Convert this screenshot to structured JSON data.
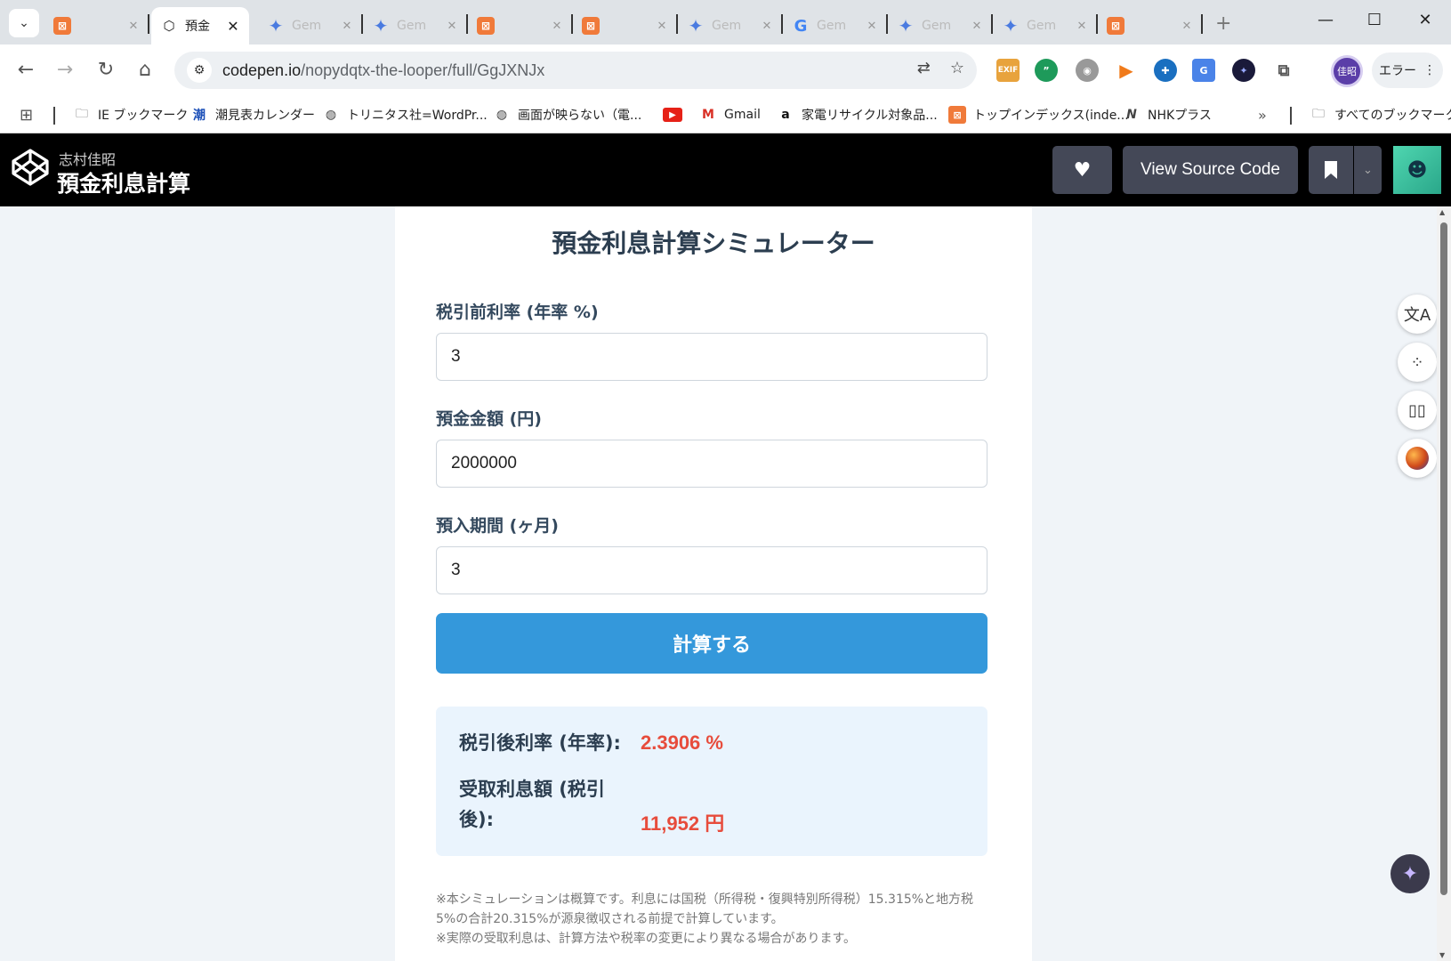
{
  "browser": {
    "tabs": [
      {
        "title": "",
        "icon": "codepen-icon"
      },
      {
        "title": "預金",
        "icon": "codepen-icon",
        "active": true
      },
      {
        "title": "Gem",
        "icon": "gemini-icon"
      },
      {
        "title": "Gem",
        "icon": "gemini-icon"
      },
      {
        "title": "",
        "icon": "codepen-icon"
      },
      {
        "title": "",
        "icon": "codepen-icon"
      },
      {
        "title": "Gem",
        "icon": "gemini-icon"
      },
      {
        "title": "Gem",
        "icon": "google-icon"
      },
      {
        "title": "Gem",
        "icon": "gemini-icon"
      },
      {
        "title": "Gem",
        "icon": "gemini-icon"
      },
      {
        "title": "",
        "icon": "codepen-icon"
      }
    ],
    "url_host": "codepen.io",
    "url_path": "/nopydqtx-the-looper/full/GgJXNJx",
    "profile_label": "佳昭",
    "error_button": "エラー",
    "bookmarks": [
      {
        "label": "IE ブックマーク",
        "icon": "folder-icon"
      },
      {
        "label": "潮見表カレンダー",
        "icon": "tide-icon"
      },
      {
        "label": "トリニタス社=WordPr...",
        "icon": "globe-icon"
      },
      {
        "label": "画面が映らない（電...",
        "icon": "globe-icon"
      },
      {
        "label": "",
        "icon": "youtube-icon"
      },
      {
        "label": "Gmail",
        "icon": "gmail-icon"
      },
      {
        "label": "家電リサイクル対象品...",
        "icon": "amazon-icon"
      },
      {
        "label": "トップインデックス(inde...",
        "icon": "codepen-icon"
      },
      {
        "label": "NHKプラス",
        "icon": "nhk-icon"
      }
    ],
    "all_bookmarks": "すべてのブックマーク",
    "colors": {
      "accent": "#3498db",
      "result_value": "#e74c3c"
    }
  },
  "codepen": {
    "author": "志村佳昭",
    "pen_title": "預金利息計算",
    "view_source": "View Source Code"
  },
  "simulator": {
    "title": "預金利息計算シミュレーター",
    "rate_label": "税引前利率 (年率 %)",
    "rate_value": "3",
    "amount_label": "預金金額 (円)",
    "amount_value": "2000000",
    "period_label": "預入期間 (ヶ月)",
    "period_value": "3",
    "button": "計算する",
    "result_rate_label": "税引後利率 (年率):",
    "result_rate_value": "2.3906 %",
    "result_interest_label_1": "受取利息額 (税引",
    "result_interest_label_2": "後):",
    "result_interest_value": "11,952 円",
    "note_1": "※本シミュレーションは概算です。利息には国税（所得税・復興特別所得税）15.315%と地方税5%の合計20.315%が源泉徴収される前提で計算しています。",
    "note_2": "※実際の受取利息は、計算方法や税率の変更により異なる場合があります。"
  }
}
